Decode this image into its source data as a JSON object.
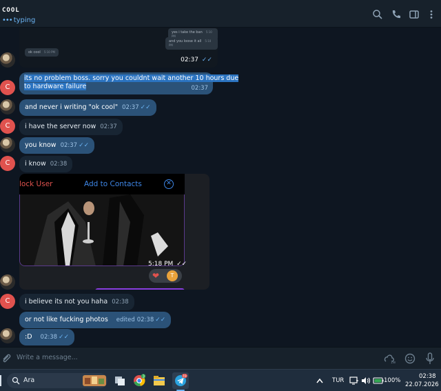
{
  "header": {
    "title": "COOL",
    "status_dots": "•••",
    "status": "typing"
  },
  "screenshot_preview": {
    "msg_out_1": "yes i take the ban",
    "msg_out_1_time": "5:10 PM",
    "msg_out_2": "and you loose it all",
    "msg_out_2_time": "5:10 PM",
    "msg_in": "ok cool",
    "msg_in_time": "5:10 PM",
    "time": "02:37"
  },
  "messages": [
    {
      "text_1": "its no problem boss. sorry you couldnt wait another 10 hours due",
      "text_2": "to hardware failure",
      "time": "02:37"
    },
    {
      "text": "and never i writing \"ok cool\"",
      "time": "02:37"
    },
    {
      "text": "i have the server now",
      "time": "02:37"
    },
    {
      "text": "you know",
      "time": "02:37"
    },
    {
      "text": "i know",
      "time": "02:38"
    },
    {
      "text": "i believe its not you haha",
      "time": "02:38"
    },
    {
      "text": "or not like fucking photos",
      "edited": "edited",
      "time": "02:38"
    },
    {
      "text": ":D",
      "time": "02:38"
    }
  ],
  "avatar_letter": "C",
  "media": {
    "block_user": "lock User",
    "add_contacts": "Add to Contacts",
    "close_glyph": "✕",
    "stamp": "5:18 PM",
    "reaction": "❤",
    "reaction_user": "T"
  },
  "input": {
    "placeholder": "Write a message..."
  },
  "taskbar": {
    "search_label": "Ara",
    "telegram_badge": "70",
    "chrome_badge": "3",
    "lang": "TUR",
    "battery": "100%",
    "time": "02:38",
    "date": "22.07.2026"
  },
  "colors": {
    "background": "#0e1621",
    "header": "#17212b",
    "incoming_bubble": "#182533",
    "outgoing_bubble": "#2b5278",
    "accent": "#6ab2f2",
    "avatar_red": "#e0524e"
  }
}
